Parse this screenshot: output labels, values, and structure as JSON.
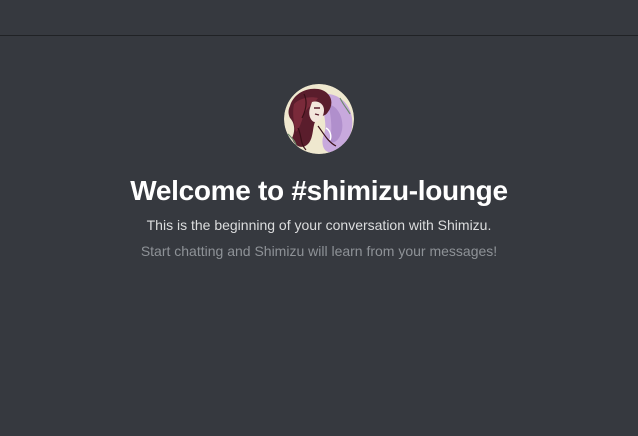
{
  "channel": {
    "name": "shimizu-lounge"
  },
  "welcome": {
    "title": "Welcome to #shimizu-lounge",
    "subtitle": "This is the beginning of your conversation with Shimizu.",
    "hint": "Start chatting and Shimizu will learn from your messages!",
    "avatar_icon": "bot-avatar"
  },
  "colors": {
    "background": "#36393f",
    "title": "#ffffff",
    "subtitle": "#dcddde",
    "hint": "#8e9297"
  }
}
